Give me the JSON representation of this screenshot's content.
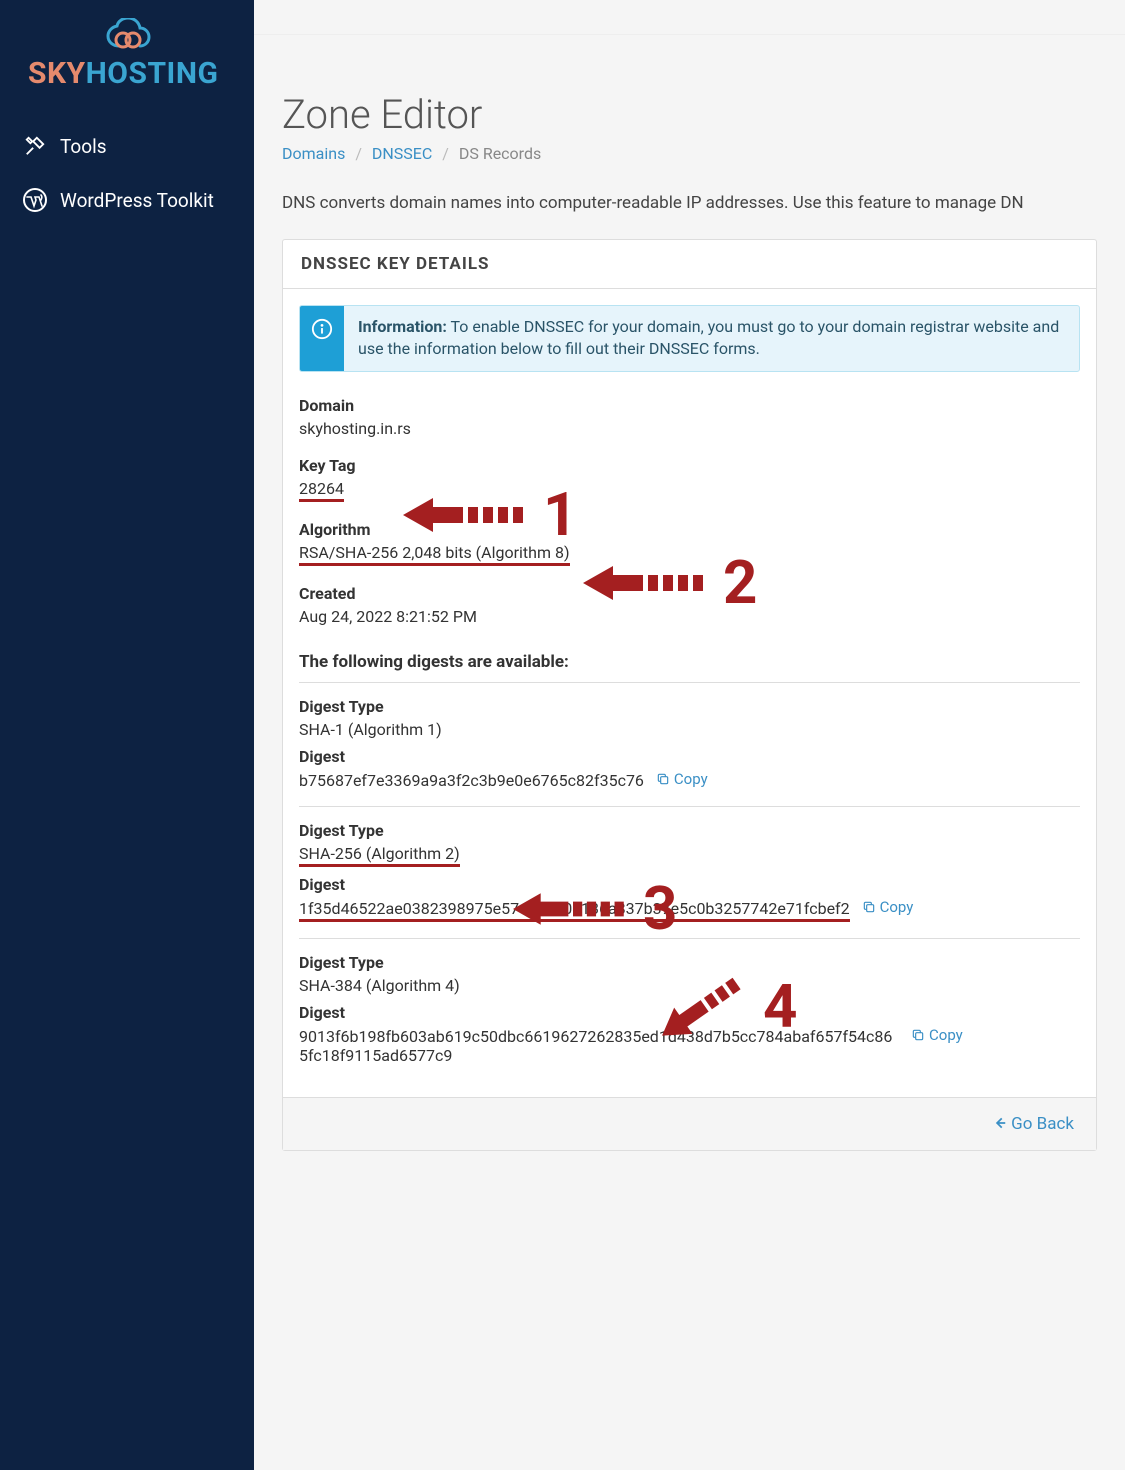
{
  "sidebar": {
    "logo": {
      "sky": "SKY",
      "host": "HOSTING"
    },
    "items": [
      {
        "label": "Tools"
      },
      {
        "label": "WordPress Toolkit"
      }
    ]
  },
  "header": {
    "title": "Zone Editor",
    "crumb1": "Domains",
    "crumb2": "DNSSEC",
    "crumb3": "DS Records"
  },
  "description": "DNS converts domain names into computer-readable IP addresses. Use this feature to manage DN",
  "panel": {
    "heading": "DNSSEC KEY DETAILS",
    "info_bold": "Information:",
    "info_text": " To enable DNSSEC for your domain, you must go to your domain registrar website and use the information below to fill out their DNSSEC forms.",
    "domain_label": "Domain",
    "domain_value": "skyhosting.in.rs",
    "keytag_label": "Key Tag",
    "keytag_value": "28264",
    "algorithm_label": "Algorithm",
    "algorithm_value": "RSA/SHA-256 2,048 bits (Algorithm 8)",
    "created_label": "Created",
    "created_value": "Aug 24, 2022 8:21:52 PM",
    "digests_title": "The following digests are available:",
    "copy_label": "Copy",
    "digests": [
      {
        "type_label": "Digest Type",
        "type_value": "SHA-1 (Algorithm 1)",
        "digest_label": "Digest",
        "digest_value": "b75687ef7e3369a9a3f2c3b9e0e6765c82f35c76"
      },
      {
        "type_label": "Digest Type",
        "type_value": "SHA-256 (Algorithm 2)",
        "digest_label": "Digest",
        "digest_value": "1f35d46522ae0382398975e57e4a470a136a837b37e5c0b3257742e71fcbef2"
      },
      {
        "type_label": "Digest Type",
        "type_value": "SHA-384 (Algorithm 4)",
        "digest_label": "Digest",
        "digest_value": "9013f6b198fb603ab619c50dbc6619627262835ed1d438d7b5cc784abaf657f54c865fc18f9115ad6577c9"
      }
    ],
    "go_back": "Go Back"
  },
  "annotations": {
    "a1": "1",
    "a2": "2",
    "a3": "3",
    "a4": "4"
  }
}
